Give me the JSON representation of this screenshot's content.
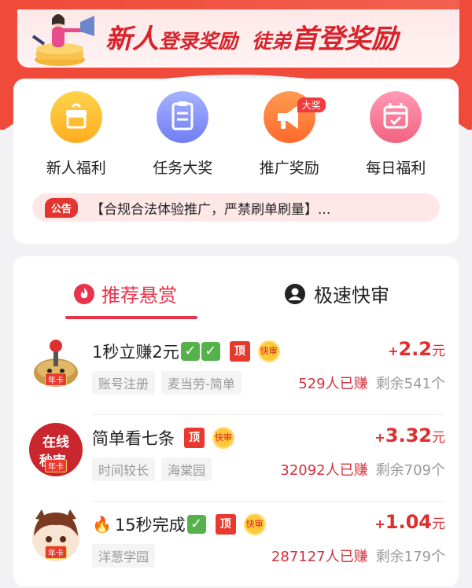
{
  "banner": {
    "part1": "新人",
    "part2": "登录奖励",
    "part3": "徒弟",
    "part4": "首登奖励"
  },
  "grid": [
    {
      "label": "新人福利",
      "icon": "gift-box-icon"
    },
    {
      "label": "任务大奖",
      "icon": "task-list-icon"
    },
    {
      "label": "推广奖励",
      "icon": "megaphone-icon",
      "badge": "大奖"
    },
    {
      "label": "每日福利",
      "icon": "calendar-icon"
    }
  ],
  "notice": {
    "tag": "公告",
    "text": "【合规合法体验推广，严禁刷单刷量】..."
  },
  "tabs": {
    "recommended": "推荐悬赏",
    "fast_review": "极速快审"
  },
  "tasks": [
    {
      "title": "1秒立赚2元",
      "ding": "顶",
      "kuai": "快审",
      "nian": "年卡",
      "reward_sign": "+",
      "reward_value": "2.2",
      "reward_unit": "元",
      "tags": [
        "账号注册",
        "麦当劳-简单"
      ],
      "earned": "529人已赚",
      "remaining": "剩余541个"
    },
    {
      "title": "简单看七条",
      "ding": "顶",
      "kuai": "快审",
      "nian": "年卡",
      "avatar_text1": "在线",
      "avatar_text2": "秒审",
      "reward_sign": "+",
      "reward_value": "3.32",
      "reward_unit": "元",
      "tags": [
        "时间较长",
        "海棠园"
      ],
      "earned": "32092人已赚",
      "remaining": "剩余709个"
    },
    {
      "title": "15秒完成",
      "ding": "顶",
      "kuai": "快审",
      "nian": "年卡",
      "reward_sign": "+",
      "reward_value": "1.04",
      "reward_unit": "元",
      "tags": [
        "洋葱学园"
      ],
      "earned": "287127人已赚",
      "remaining": "剩余179个"
    }
  ],
  "colors": {
    "brand_red": "#ef4a3a",
    "active_tab": "#e8334b",
    "reward": "#e02e2e"
  }
}
